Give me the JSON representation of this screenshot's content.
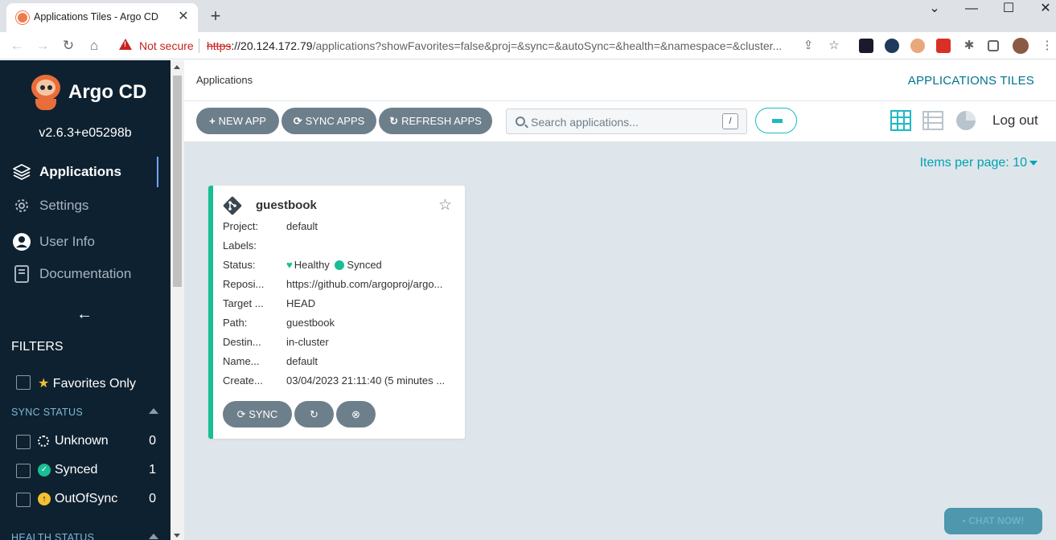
{
  "browser": {
    "tab_title": "Applications Tiles - Argo CD",
    "close_glyph": "✕",
    "new_tab_glyph": "+",
    "not_secure": "Not secure",
    "url_scheme": "https",
    "url_host": "://20.124.172.79",
    "url_rest": "/applications?showFavorites=false&proj=&sync=&autoSync=&health=&namespace=&cluster..."
  },
  "sidebar": {
    "brand": "Argo CD",
    "version": "v2.6.3+e05298b",
    "nav": [
      {
        "label": "Applications",
        "icon": "layers-icon",
        "active": true
      },
      {
        "label": "Settings",
        "icon": "gear-icon",
        "active": false
      },
      {
        "label": "User Info",
        "icon": "user-icon",
        "active": false
      },
      {
        "label": "Documentation",
        "icon": "book-icon",
        "active": false
      }
    ],
    "filters_title": "FILTERS",
    "favorites_label": "Favorites Only",
    "sync_status_title": "SYNC STATUS",
    "sync_filters": [
      {
        "label": "Unknown",
        "count": "0",
        "color": "#ffffff"
      },
      {
        "label": "Synced",
        "count": "1",
        "color": "#18be94"
      },
      {
        "label": "OutOfSync",
        "count": "0",
        "color": "#f4c030"
      }
    ],
    "health_status_title": "HEALTH STATUS"
  },
  "header": {
    "breadcrumb": "Applications",
    "title": "APPLICATIONS TILES"
  },
  "toolbar": {
    "new_app": "NEW APP",
    "sync_apps": "SYNC APPS",
    "refresh_apps": "REFRESH APPS",
    "search_placeholder": "Search applications...",
    "search_shortcut": "/",
    "logout": "Log out"
  },
  "content": {
    "items_per_page": "Items per page: 10"
  },
  "app_card": {
    "name": "guestbook",
    "fields": [
      {
        "key": "Project:",
        "value": "default"
      },
      {
        "key": "Labels:",
        "value": ""
      },
      {
        "key": "Status:",
        "value": ""
      },
      {
        "key": "Reposi...",
        "value": "https://github.com/argoproj/argo..."
      },
      {
        "key": "Target ...",
        "value": "HEAD"
      },
      {
        "key": "Path:",
        "value": "guestbook"
      },
      {
        "key": "Destin...",
        "value": "in-cluster"
      },
      {
        "key": "Name...",
        "value": "default"
      },
      {
        "key": "Create...",
        "value": "03/04/2023 21:11:40  (5 minutes ..."
      }
    ],
    "health": "Healthy",
    "sync": "Synced",
    "sync_button": "SYNC"
  },
  "chat": {
    "label": "CHAT NOW!"
  },
  "colors": {
    "sidebar_bg": "#0e2130",
    "accent": "#00a2b3",
    "healthy": "#18be94",
    "button": "#6d7f8b"
  }
}
